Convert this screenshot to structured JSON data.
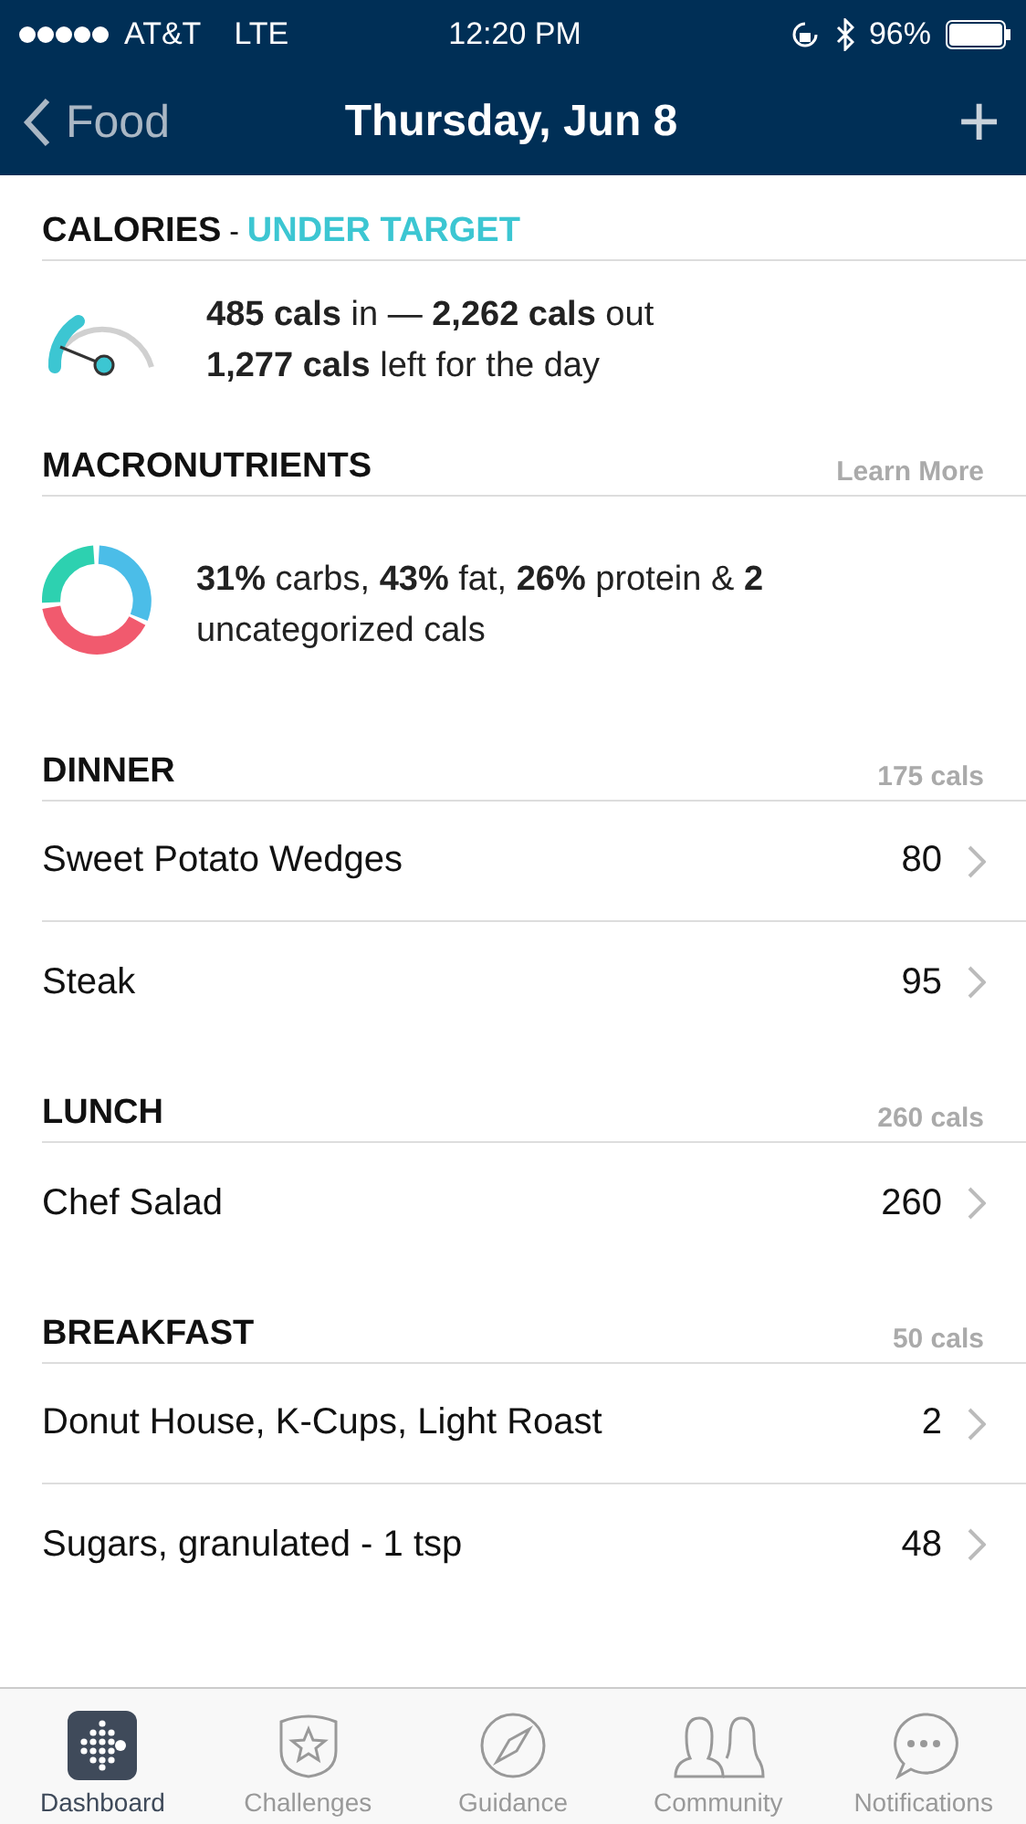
{
  "status_bar": {
    "carrier": "AT&T",
    "network": "LTE",
    "time": "12:20 PM",
    "battery": "96%"
  },
  "nav": {
    "back": "Food",
    "title": "Thursday, Jun 8",
    "add": "+"
  },
  "calories": {
    "title": "CALORIES",
    "separator": "-",
    "status": "UNDER TARGET",
    "line_1": "**485 cals** in — **2,262 cals** out",
    "line_2": "**1,277 cals** left for the day"
  },
  "macronutrients": {
    "title": "MACRONUTRIENTS",
    "link": "Learn More",
    "summary": "**31%** carbs, **43%** fat, **26%** protein & **2** uncategorized cals"
  },
  "meals": [
    {
      "name": "DINNER",
      "total": "175 cals",
      "items": [
        {
          "name": "Sweet Potato Wedges",
          "cals": "80"
        },
        {
          "name": "Steak",
          "cals": "95"
        }
      ]
    },
    {
      "name": "LUNCH",
      "total": "260 cals",
      "items": [
        {
          "name": "Chef Salad",
          "cals": "260"
        }
      ]
    },
    {
      "name": "BREAKFAST",
      "total": "50 cals",
      "items": [
        {
          "name": "Donut House, K-Cups, Light Roast",
          "cals": "2"
        },
        {
          "name": "Sugars, granulated - 1 tsp",
          "cals": "48"
        }
      ]
    }
  ],
  "tabs": [
    {
      "label": "Dashboard",
      "kind": "dashboard",
      "selected": true
    },
    {
      "label": "Challenges",
      "kind": "challenges",
      "selected": false
    },
    {
      "label": "Guidance",
      "kind": "guidance",
      "selected": false
    },
    {
      "label": "Community",
      "kind": "community",
      "selected": false
    },
    {
      "label": "Notifications",
      "kind": "notifications",
      "selected": false
    }
  ]
}
